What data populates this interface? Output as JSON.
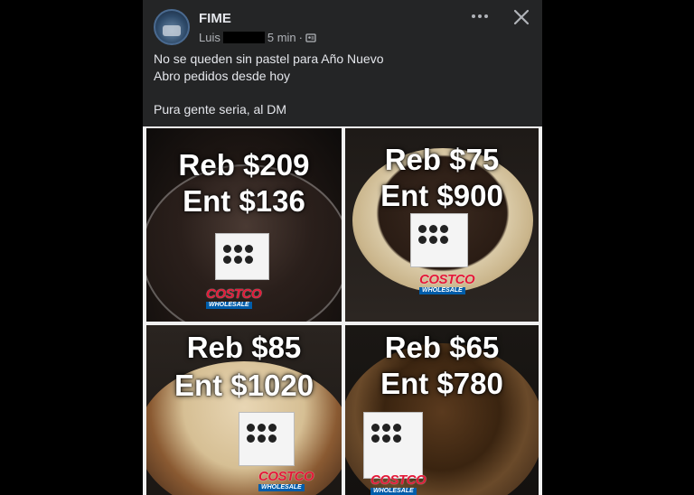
{
  "post": {
    "group_name": "FIME",
    "author_name": "Luis",
    "time": "5 min",
    "separator": "·",
    "text_lines": [
      "No se queden sin pastel para Año Nuevo",
      "Abro pedidos desde hoy"
    ],
    "text_closing": "Pura gente seria, al DM"
  },
  "actions": {
    "more_icon": "more-dots-icon",
    "close_icon": "close-icon"
  },
  "photos": [
    {
      "resale": "Reb $209",
      "delivery": "Ent $136",
      "brand": "COSTCO",
      "brand_sub": "WHOLESALE"
    },
    {
      "resale": "Reb $75",
      "delivery": "Ent $900",
      "brand": "COSTCO",
      "brand_sub": "WHOLESALE"
    },
    {
      "resale": "Reb $85",
      "delivery": "Ent $1020",
      "brand": "COSTCO",
      "brand_sub": "WHOLESALE"
    },
    {
      "resale": "Reb $65",
      "delivery": "Ent $780",
      "brand": "COSTCO",
      "brand_sub": "WHOLESALE"
    }
  ],
  "colors": {
    "card_bg": "#242526",
    "text_primary": "#e4e6eb",
    "text_secondary": "#b0b3b8",
    "costco_red": "#e31837",
    "costco_blue": "#005daa"
  }
}
